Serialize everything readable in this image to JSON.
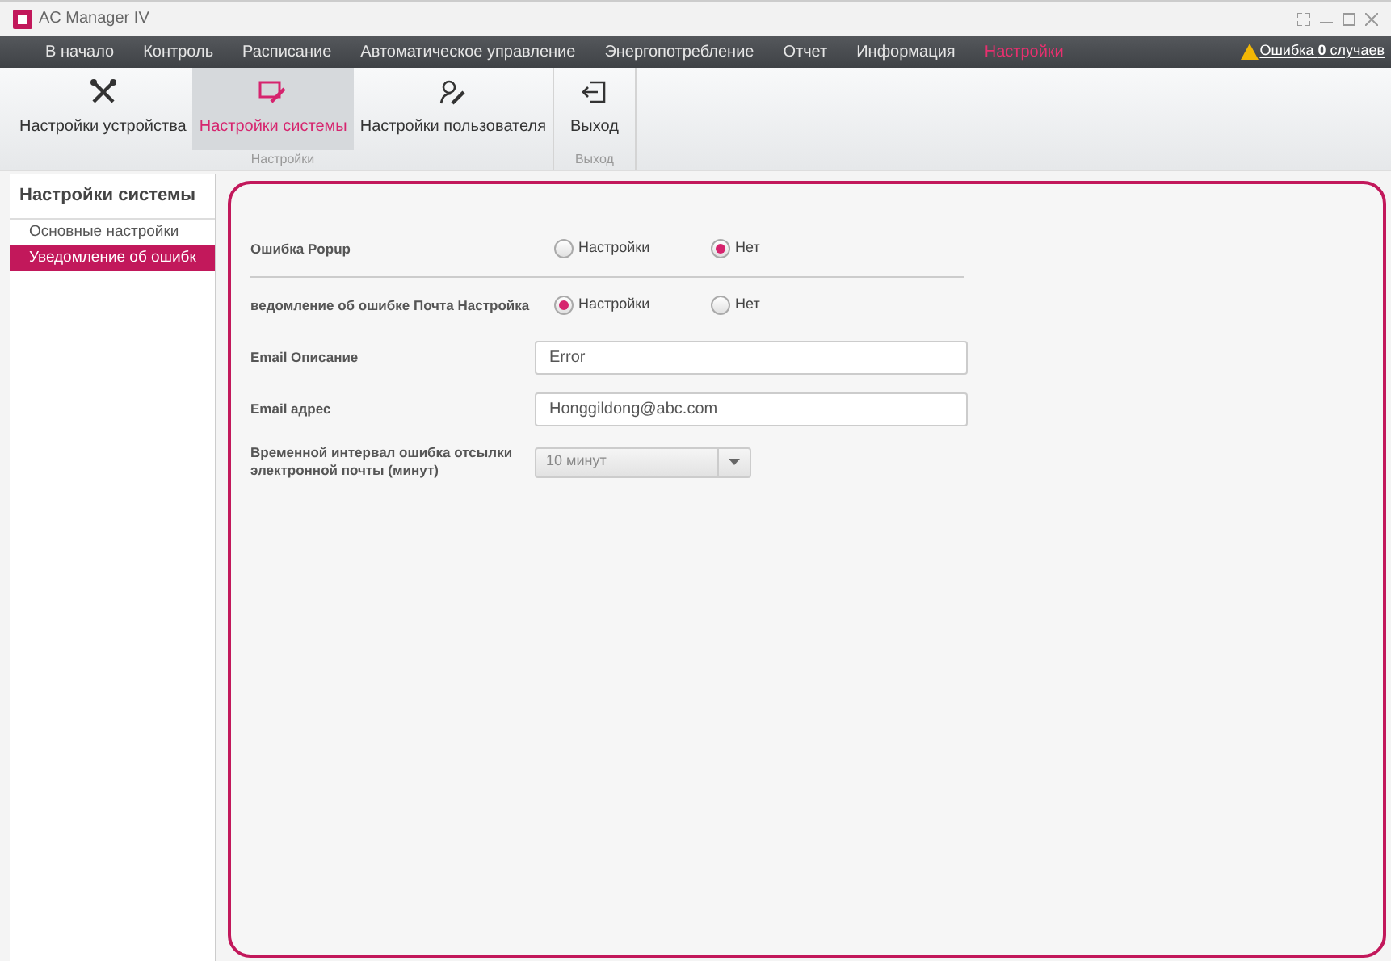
{
  "window": {
    "title": "AC Manager IV"
  },
  "menu": [
    {
      "label": "В начало",
      "selected": false
    },
    {
      "label": "Контроль",
      "selected": false
    },
    {
      "label": "Расписание",
      "selected": false
    },
    {
      "label": "Автоматическое управление",
      "selected": false
    },
    {
      "label": "Энергопотребление",
      "selected": false
    },
    {
      "label": "Отчет",
      "selected": false
    },
    {
      "label": "Информация",
      "selected": false
    },
    {
      "label": "Настройки",
      "selected": true
    }
  ],
  "alert": {
    "text": "Ошибка **0** случаев"
  },
  "ribbon": {
    "groups": [
      {
        "label": "Настройки",
        "buttons": [
          {
            "label": "Настройки устройства",
            "kind": "tools",
            "selected": false
          },
          {
            "label": "Настройки системы",
            "kind": "system",
            "selected": true
          },
          {
            "label": "Настройки пользователя",
            "kind": "user",
            "selected": false
          }
        ]
      },
      {
        "label": "Выход",
        "buttons": [
          {
            "label": "Выход",
            "kind": "exit",
            "selected": false
          }
        ]
      }
    ]
  },
  "sidebar": {
    "title": "Настройки системы",
    "items": [
      {
        "label": "Основные настройки",
        "selected": false
      },
      {
        "label": "Уведомление об ошибк",
        "selected": true
      }
    ]
  },
  "form": {
    "rows": [
      {
        "kind": "radio",
        "label": "Ошибка Popup",
        "options": [
          {
            "label": "Настройки",
            "selected": false
          },
          {
            "label": "Нет",
            "selected": true
          }
        ],
        "divider": true
      },
      {
        "kind": "radio",
        "label": "ведомление об ошибке Почта Настройка",
        "options": [
          {
            "label": "Настройки",
            "selected": true
          },
          {
            "label": "Нет",
            "selected": false
          }
        ]
      },
      {
        "kind": "text",
        "label": "Email Описание",
        "value": "Error"
      },
      {
        "kind": "text",
        "label": "Email адрес",
        "value": "Honggildong@abc.com"
      },
      {
        "kind": "select",
        "label": "Временной интервал ошибка отсылки электронной почты (минут)",
        "value": "10 минут"
      }
    ]
  }
}
